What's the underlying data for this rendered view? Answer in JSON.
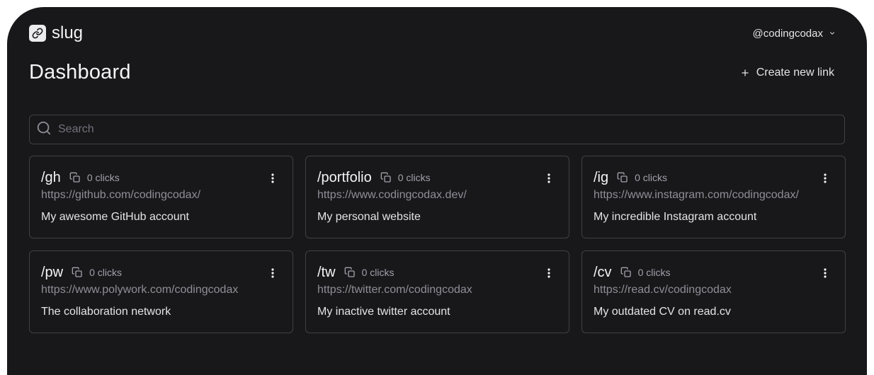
{
  "app": {
    "name": "slug",
    "logo_icon": "link-icon"
  },
  "user_menu": {
    "username": "@codingcodax",
    "icon": "chevron-down-icon"
  },
  "header": {
    "title": "Dashboard",
    "create_button": {
      "label": "Create new link",
      "icon": "plus-icon"
    }
  },
  "search": {
    "placeholder": "Search",
    "value": "",
    "icon": "search-icon"
  },
  "links": [
    {
      "slug": "/gh",
      "clicks": "0 clicks",
      "url": "https://github.com/codingcodax/",
      "description": "My awesome GitHub account"
    },
    {
      "slug": "/portfolio",
      "clicks": "0 clicks",
      "url": "https://www.codingcodax.dev/",
      "description": "My personal website"
    },
    {
      "slug": "/ig",
      "clicks": "0 clicks",
      "url": "https://www.instagram.com/codingcodax/",
      "description": "My incredible Instagram account"
    },
    {
      "slug": "/pw",
      "clicks": "0 clicks",
      "url": "https://www.polywork.com/codingcodax",
      "description": "The collaboration network"
    },
    {
      "slug": "/tw",
      "clicks": "0 clicks",
      "url": "https://twitter.com/codingcodax",
      "description": "My inactive twitter account"
    },
    {
      "slug": "/cv",
      "clicks": "0 clicks",
      "url": "https://read.cv/codingcodax",
      "description": "My outdated CV on read.cv"
    }
  ],
  "colors": {
    "background": "#18181b",
    "border": "#3f3f46",
    "text_primary": "#f4f4f5",
    "text_muted": "#a1a1aa"
  }
}
